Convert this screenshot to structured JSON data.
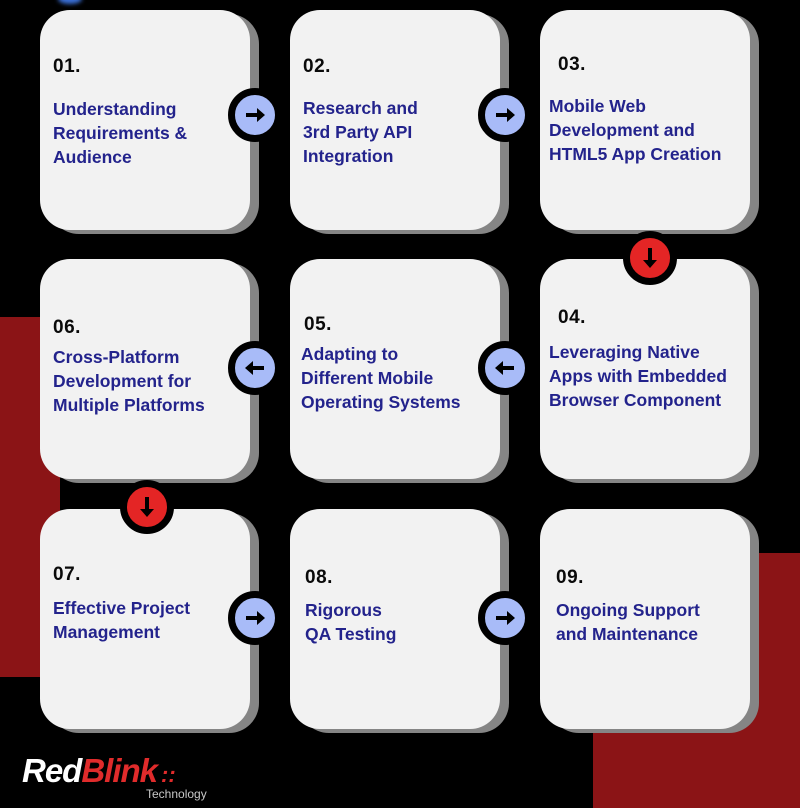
{
  "steps": [
    {
      "number": "01.",
      "title": "Understanding\nRequirements &\nAudience"
    },
    {
      "number": "02.",
      "title": "Research and\n3rd Party API\nIntegration"
    },
    {
      "number": "03.",
      "title": "Mobile Web\nDevelopment and\nHTML5 App Creation"
    },
    {
      "number": "04.",
      "title": "Leveraging Native\nApps with Embedded\nBrowser Component"
    },
    {
      "number": "05.",
      "title": "Adapting to\nDifferent Mobile\nOperating Systems"
    },
    {
      "number": "06.",
      "title": "Cross-Platform\nDevelopment for\nMultiple Platforms"
    },
    {
      "number": "07.",
      "title": "Effective Project\nManagement"
    },
    {
      "number": "08.",
      "title": "Rigorous\nQA Testing"
    },
    {
      "number": "09.",
      "title": "Ongoing Support\nand Maintenance"
    }
  ],
  "connectors": [
    {
      "from": "01",
      "to": "02",
      "direction": "right",
      "icon": "arrow-right-icon",
      "color": "#a8bbf8"
    },
    {
      "from": "02",
      "to": "03",
      "direction": "right",
      "icon": "arrow-right-icon",
      "color": "#a8bbf8"
    },
    {
      "from": "03",
      "to": "04",
      "direction": "down",
      "icon": "arrow-down-icon",
      "color": "#e42525"
    },
    {
      "from": "04",
      "to": "05",
      "direction": "left",
      "icon": "arrow-left-icon",
      "color": "#a8bbf8"
    },
    {
      "from": "05",
      "to": "06",
      "direction": "left",
      "icon": "arrow-left-icon",
      "color": "#a8bbf8"
    },
    {
      "from": "06",
      "to": "07",
      "direction": "down",
      "icon": "arrow-down-icon",
      "color": "#e42525"
    },
    {
      "from": "07",
      "to": "08",
      "direction": "right",
      "icon": "arrow-right-icon",
      "color": "#a8bbf8"
    },
    {
      "from": "08",
      "to": "09",
      "direction": "right",
      "icon": "arrow-right-icon",
      "color": "#a8bbf8"
    }
  ],
  "logo": {
    "part1": "Red",
    "part2": "Blink",
    "mark": "::",
    "subtitle": "Technology"
  },
  "colors": {
    "background": "#000000",
    "accent_red": "#8b1416",
    "card": "#f2f2f2",
    "title_text": "#23238c",
    "connector_blue": "#a8bbf8",
    "connector_red": "#e42525"
  }
}
